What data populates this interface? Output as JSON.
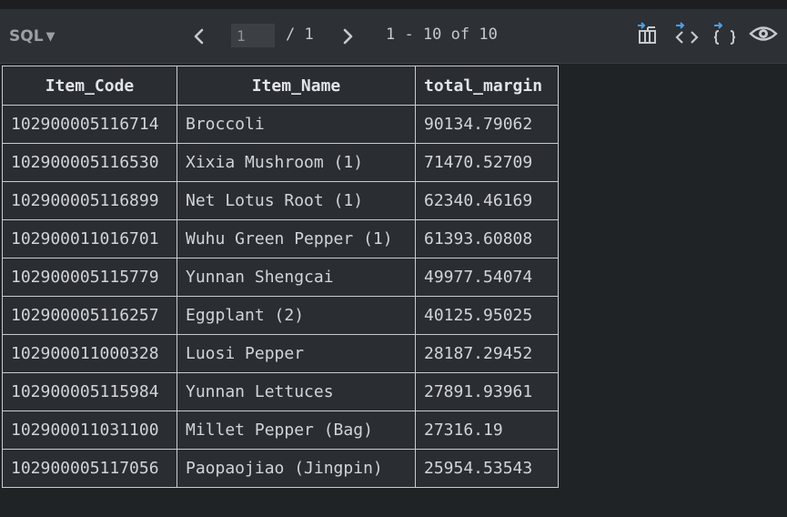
{
  "toolbar": {
    "language": "SQL",
    "caret": "▼",
    "page_value": "1",
    "page_total": "/ 1",
    "range": "1 - 10 of 10",
    "icons": [
      "chevron-left-icon",
      "chevron-right-icon",
      "export-table-icon",
      "export-code-icon",
      "export-json-icon",
      "eye-icon"
    ]
  },
  "colors": {
    "background": "#202326",
    "toolbar": "#2d3034",
    "accent_blue": "#4a9fe8",
    "text": "#d1d4d8"
  },
  "table": {
    "headers": [
      "Item_Code",
      "Item_Name",
      "total_margin"
    ],
    "rows": [
      [
        "102900005116714",
        "Broccoli",
        "90134.79062"
      ],
      [
        "102900005116530",
        "Xixia Mushroom (1)",
        "71470.52709"
      ],
      [
        "102900005116899",
        "Net Lotus Root (1)",
        "62340.46169"
      ],
      [
        "102900011016701",
        "Wuhu Green Pepper (1)",
        "61393.60808"
      ],
      [
        "102900005115779",
        "Yunnan Shengcai",
        "49977.54074"
      ],
      [
        "102900005116257",
        "Eggplant (2)",
        "40125.95025"
      ],
      [
        "102900011000328",
        "Luosi Pepper",
        "28187.29452"
      ],
      [
        "102900005115984",
        "Yunnan Lettuces",
        "27891.93961"
      ],
      [
        "102900011031100",
        "Millet Pepper (Bag)",
        "27316.19"
      ],
      [
        "102900005117056",
        "Paopaojiao (Jingpin)",
        "25954.53543"
      ]
    ]
  }
}
